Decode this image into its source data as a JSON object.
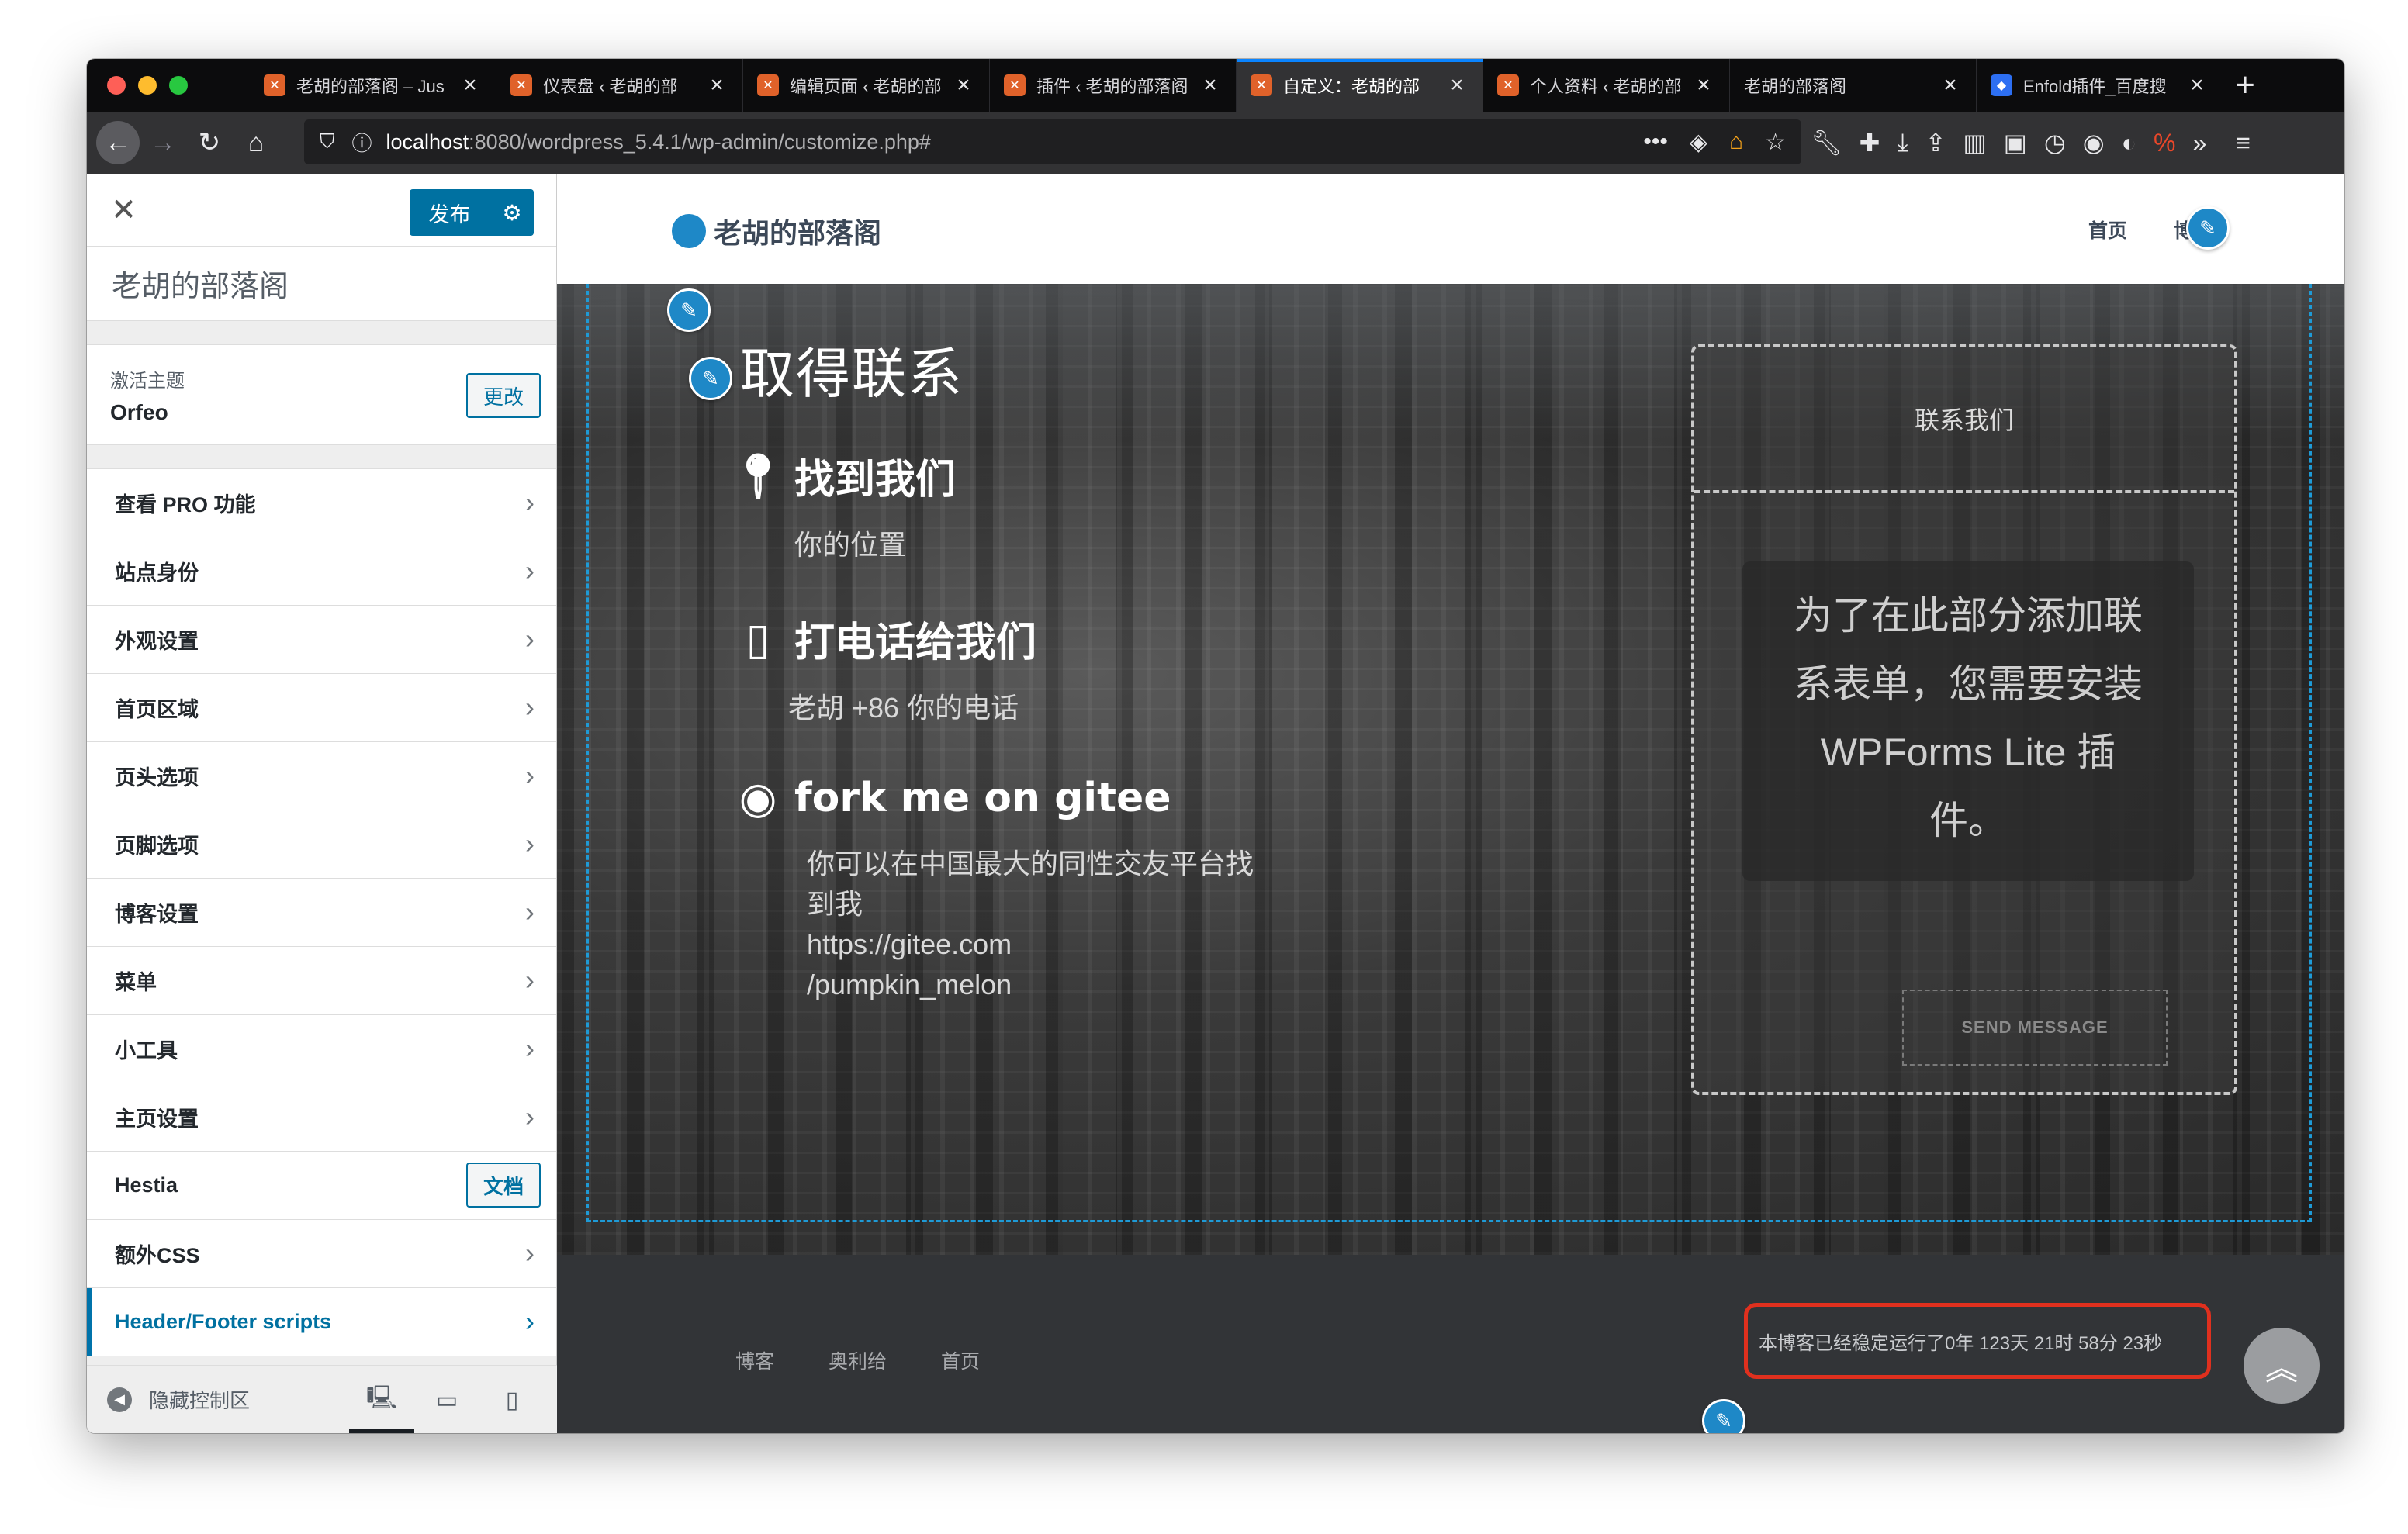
{
  "browser": {
    "tabs": [
      {
        "title": "老胡的部落阁 – Jus",
        "favicon": "xampp"
      },
      {
        "title": "仪表盘 ‹ 老胡的部",
        "favicon": "xampp"
      },
      {
        "title": "编辑页面 ‹ 老胡的部",
        "favicon": "xampp"
      },
      {
        "title": "插件 ‹ 老胡的部落阁",
        "favicon": "xampp"
      },
      {
        "title": "自定义：老胡的部",
        "favicon": "xampp",
        "active": true
      },
      {
        "title": "个人资料 ‹ 老胡的部",
        "favicon": "xampp"
      },
      {
        "title": "老胡的部落阁",
        "favicon": "none"
      },
      {
        "title": "Enfold插件_百度搜",
        "favicon": "baidu"
      }
    ],
    "url": {
      "host": "localhost",
      "path": ":8080/wordpress_5.4.1/wp-admin/customize.php#"
    }
  },
  "customizer": {
    "publish_label": "发布",
    "site_title": "老胡的部落阁",
    "active_theme_label": "激活主题",
    "theme_name": "Orfeo",
    "change_label": "更改",
    "menu": [
      {
        "label": "查看 PRO 功能",
        "kind": "section"
      },
      {
        "label": "站点身份",
        "kind": "section"
      },
      {
        "label": "外观设置",
        "kind": "section"
      },
      {
        "label": "首页区域",
        "kind": "section"
      },
      {
        "label": "页头选项",
        "kind": "section"
      },
      {
        "label": "页脚选项",
        "kind": "section"
      },
      {
        "label": "博客设置",
        "kind": "section"
      },
      {
        "label": "菜单",
        "kind": "section"
      },
      {
        "label": "小工具",
        "kind": "section"
      },
      {
        "label": "主页设置",
        "kind": "section"
      },
      {
        "label": "Hestia",
        "kind": "docs",
        "button": "文档"
      },
      {
        "label": "额外CSS",
        "kind": "section"
      },
      {
        "label": "Header/Footer scripts",
        "kind": "section",
        "highlighted": true
      }
    ],
    "collapse_label": "隐藏控制区"
  },
  "preview": {
    "site_name": "老胡的部落阁",
    "nav": [
      "首页",
      "博客"
    ],
    "contact": {
      "title": "取得联系",
      "items": [
        {
          "icon": "map-marker-icon",
          "heading": "找到我们",
          "text": [
            "你的位置"
          ]
        },
        {
          "icon": "mobile-phone-icon",
          "heading": "打电话给我们",
          "text": [
            "老胡 +86 你的电话"
          ]
        },
        {
          "icon": "github-icon",
          "heading": "fork me on gitee",
          "text": [
            "你可以在中国最大的同性交友平台找",
            "到我",
            "https://gitee.com",
            "/pumpkin_melon"
          ]
        }
      ],
      "form_title": "联系我们",
      "form_notice": [
        "为了在此部分添加联",
        "系表单，您需要安装",
        "WPForms Lite 插",
        "件。"
      ],
      "send_label": "SEND MESSAGE"
    },
    "footer": {
      "links": [
        "博客",
        "奥利给",
        "首页"
      ],
      "runtime": "本博客已经稳定运行了0年 123天 21时 58分 23秒"
    }
  }
}
